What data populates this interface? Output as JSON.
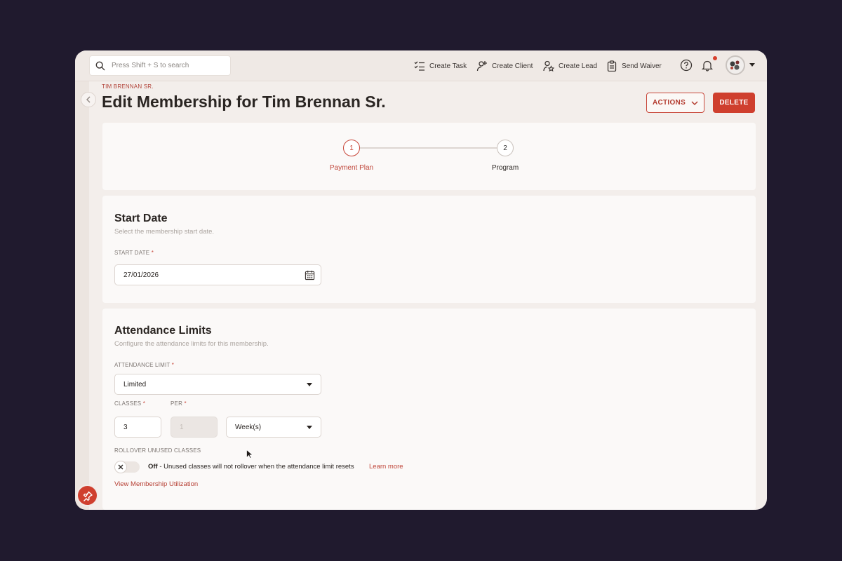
{
  "search": {
    "placeholder": "Press Shift + S to search"
  },
  "topbar": {
    "create_task": "Create Task",
    "create_client": "Create Client",
    "create_lead": "Create Lead",
    "send_waiver": "Send Waiver"
  },
  "header": {
    "breadcrumb": "TIM BRENNAN SR.",
    "title": "Edit Membership for Tim Brennan Sr.",
    "actions_label": "ACTIONS",
    "delete_label": "DELETE"
  },
  "stepper": {
    "steps": [
      {
        "number": "1",
        "label": "Payment Plan",
        "state": "active"
      },
      {
        "number": "2",
        "label": "Program",
        "state": "upcoming"
      }
    ]
  },
  "start_date": {
    "title": "Start Date",
    "subtitle": "Select the membership start date.",
    "field_label": "START DATE",
    "required_mark": "*",
    "value": "27/01/2026"
  },
  "attendance": {
    "title": "Attendance Limits",
    "subtitle": "Configure the attendance limits for this membership.",
    "limit_label": "ATTENDANCE LIMIT",
    "limit_value": "Limited",
    "classes_label": "CLASSES",
    "classes_value": "3",
    "per_label": "PER",
    "per_value": "1",
    "period_value": "Week(s)",
    "required_mark": "*",
    "rollover_label": "ROLLOVER UNUSED CLASSES",
    "rollover_state": "Off",
    "rollover_desc": " - Unused classes will not rollover when the attendance limit resets",
    "learn_more": "Learn more",
    "utilization_link": "View Membership Utilization"
  },
  "colors": {
    "accent": "#cf3f2e",
    "backdrop": "#201a2e",
    "card": "#fbf9f8"
  }
}
